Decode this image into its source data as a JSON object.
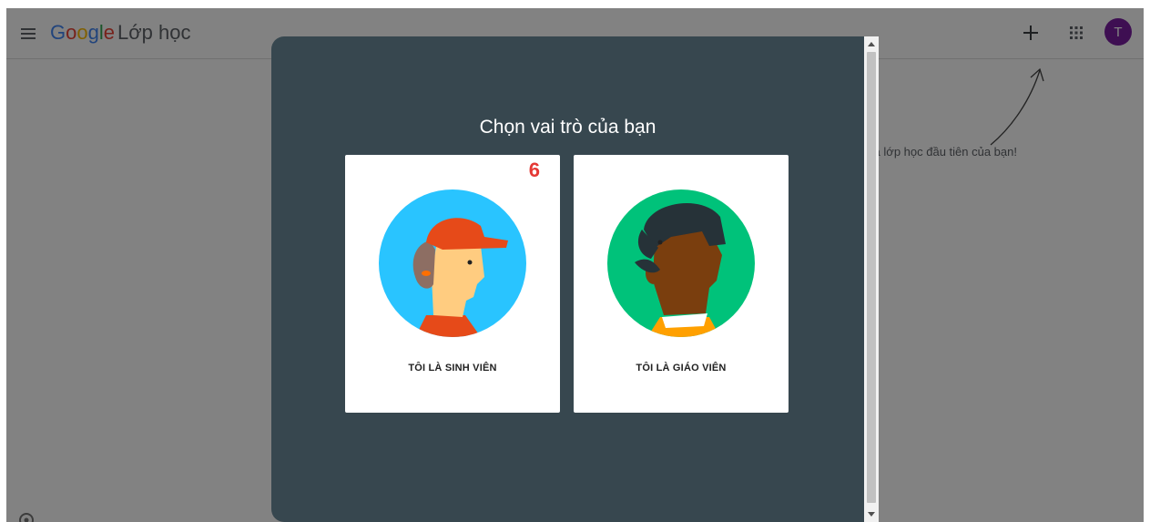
{
  "header": {
    "logo_google": [
      "G",
      "o",
      "o",
      "g",
      "l",
      "e"
    ],
    "product_name": "Lớp học",
    "avatar_initial": "T"
  },
  "page": {
    "hint_text": "m gia lớp học đầu tiên của bạn!"
  },
  "dialog": {
    "title": "Chọn vai trò của bạn",
    "cards": [
      {
        "label": "TÔI LÀ SINH VIÊN",
        "badge": "6"
      },
      {
        "label": "TÔI LÀ GIÁO VIÊN"
      }
    ]
  },
  "colors": {
    "dialog_bg": "#37474f",
    "avatar_bg": "#7b1fa2",
    "badge": "#e53935",
    "student_circle": "#29c4ff",
    "teacher_circle": "#00c27a"
  },
  "icons": [
    "menu-icon",
    "plus-icon",
    "apps-grid-icon",
    "hand-drawn-arrow-icon",
    "settings-icon",
    "scroll-up-icon",
    "scroll-down-icon"
  ]
}
